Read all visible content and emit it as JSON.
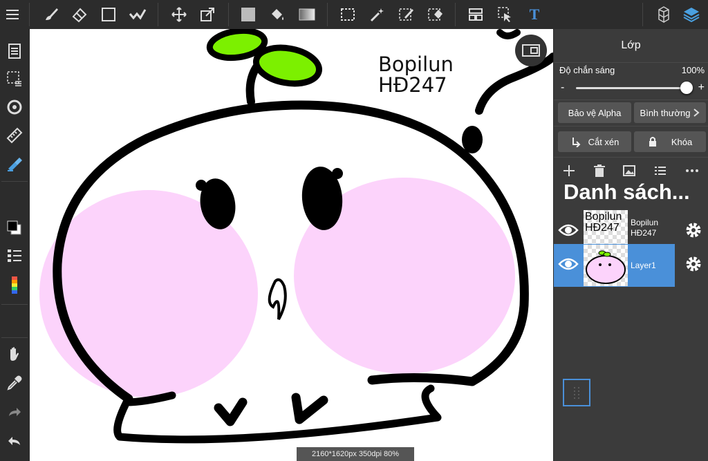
{
  "toolbar": {
    "icons": [
      "menu-icon",
      "brush-icon",
      "eraser-icon",
      "rectangle-icon",
      "smudge-icon",
      "move-icon",
      "transform-icon",
      "fill-color-icon",
      "bucket-icon",
      "gradient-icon",
      "select-rect-icon",
      "magic-wand-icon",
      "select-pen-icon",
      "select-eraser-icon",
      "panel-layout-icon",
      "select-layer-icon",
      "text-tool-icon",
      "3d-icon",
      "layers-icon"
    ],
    "text_tool_label": "T"
  },
  "status": {
    "text": "2160*1620px 350dpi 80%"
  },
  "canvas": {
    "text_line1": "Bopilun",
    "text_line2": "HĐ247"
  },
  "panel": {
    "title": "Lớp",
    "opacity_label": "Độ chắn sáng",
    "opacity_value": "100%",
    "opacity_level": 1.0,
    "minus": "-",
    "plus": "+",
    "alpha_protect": "Bảo vệ Alpha",
    "blend_mode": "Bình thường",
    "clipping": "Cắt xén",
    "lock": "Khóa",
    "list_heading": "Danh sách...",
    "layers": [
      {
        "name_line1": "Bopilun",
        "name_line2": "HĐ247",
        "thumb_line1": "Bopilun",
        "thumb_line2": "HĐ247",
        "selected": false
      },
      {
        "name_line1": "Layer1",
        "selected": true
      }
    ]
  },
  "colors": {
    "accent": "#4a90d9",
    "leaf": "#7cf000",
    "cheek": "#fcd3fb",
    "selected_layer": "#4a90d9"
  }
}
